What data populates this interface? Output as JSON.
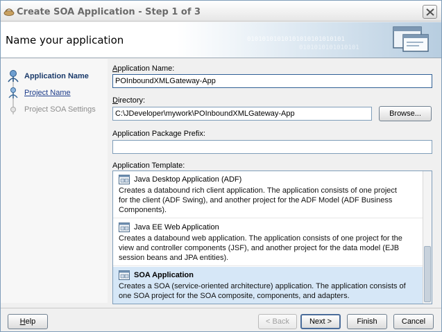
{
  "window": {
    "title": "Create SOA Application - Step 1 of 3"
  },
  "header": {
    "title": "Name your application",
    "binary_line1": "01010101010101010101010101",
    "binary_line2": "0101010101010101"
  },
  "nav": {
    "items": [
      {
        "label": "Application Name",
        "state": "active"
      },
      {
        "label": "Project Name",
        "state": "link"
      },
      {
        "label": "Project SOA Settings",
        "state": "disabled"
      }
    ]
  },
  "form": {
    "app_name_label_pre": "",
    "app_name_label_mn": "A",
    "app_name_label_post": "pplication Name:",
    "app_name_value": "POInboundXMLGateway-App",
    "directory_label_pre": "",
    "directory_label_mn": "D",
    "directory_label_post": "irectory:",
    "directory_value": "C:\\JDeveloper\\mywork\\POInboundXMLGateway-App",
    "browse_label": "Browse...",
    "prefix_label": "Application Package Prefix:",
    "prefix_value": "",
    "template_label": "Application Template:"
  },
  "templates": [
    {
      "name": "Java Desktop Application (ADF)",
      "desc": "Creates a databound rich client application. The application consists of one project\nfor the client (ADF Swing), and another project for the ADF Model (ADF Business\nComponents).",
      "selected": false
    },
    {
      "name": "Java EE Web Application",
      "desc": "Creates a databound web application. The application consists of one project for the\nview and controller components (JSF), and another project for the data model (EJB\nsession beans and JPA entities).",
      "selected": false
    },
    {
      "name": "SOA Application",
      "desc": "Creates a SOA (service-oriented architecture) application. The application consists of\none SOA project for the SOA composite, components, and adapters.",
      "selected": true
    }
  ],
  "footer": {
    "help": "Help",
    "back": "< Back",
    "next": "Next >",
    "finish": "Finish",
    "cancel": "Cancel"
  },
  "colors": {
    "accent": "#4a6c9a",
    "selection": "#d6e7f7",
    "link": "#1c3c8a"
  },
  "icons": [
    "app-icon",
    "close-icon",
    "step-active-icon",
    "step-link-icon",
    "step-disabled-icon",
    "template-icon"
  ]
}
